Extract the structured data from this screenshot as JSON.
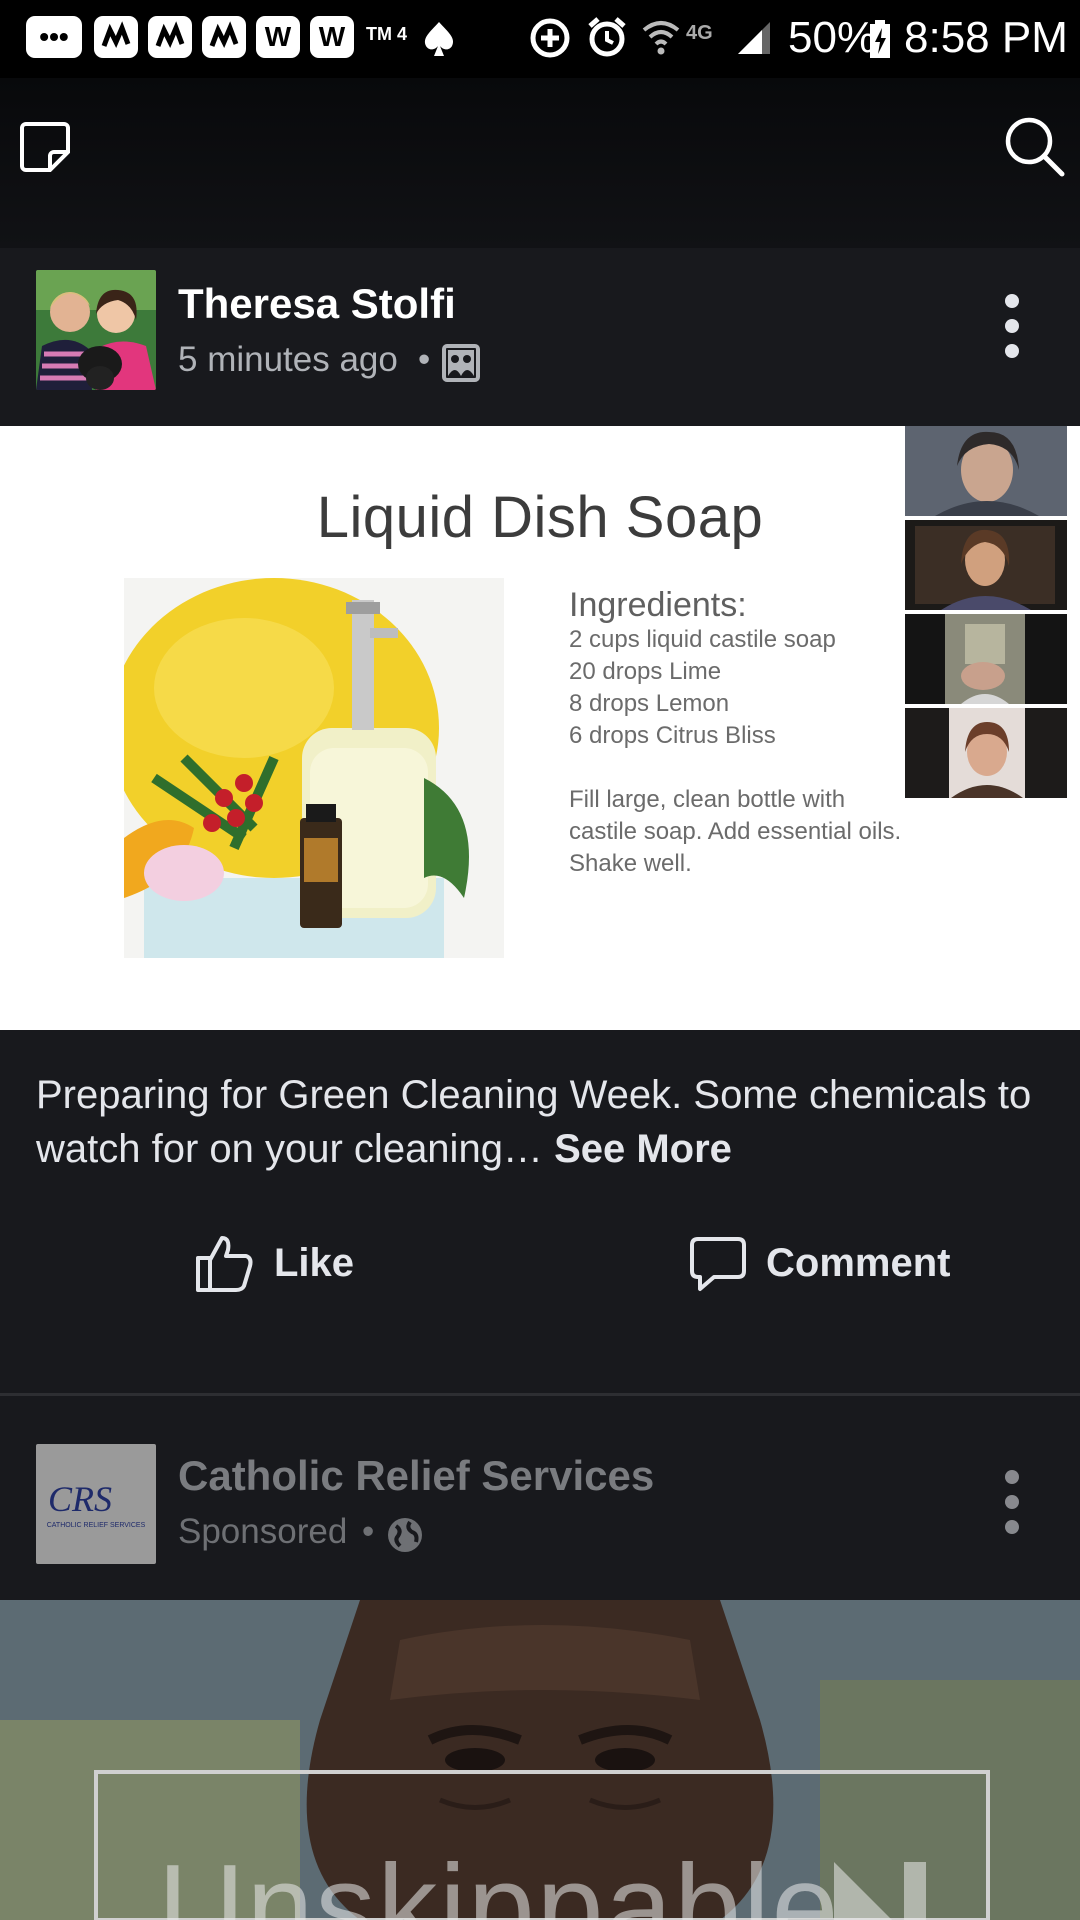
{
  "status_bar": {
    "badges": [
      "•••",
      "W",
      "W"
    ],
    "tmobile_label": "TM 4",
    "network": "4G",
    "battery": "50%",
    "time": "8:58 PM"
  },
  "post": {
    "author": "Theresa Stolfi",
    "time": "5 minutes ago",
    "separator": "•",
    "slide": {
      "title": "Liquid Dish Soap",
      "ingredients_heading": "Ingredients:",
      "ingredients": [
        "2 cups liquid castile soap",
        "20 drops Lime",
        "8 drops Lemon",
        "6 drops Citrus Bliss"
      ],
      "instructions": [
        "Fill large, clean bottle with",
        "castile soap. Add essential oils.",
        "Shake well."
      ]
    },
    "caption": "Preparing for Green Cleaning Week.  Some chemicals to watch for on your cleaning…",
    "see_more": "See More",
    "like_label": "Like",
    "comment_label": "Comment"
  },
  "ad": {
    "advertiser": "Catholic Relief Services",
    "logo_text": "CRS",
    "logo_subtext": "CATHOLIC RELIEF SERVICES",
    "sponsored": "Sponsored",
    "separator": "•",
    "overlay_text": "Unskippable"
  },
  "colors": {
    "background": "#18191d",
    "text_primary": "#e4e6eb",
    "text_secondary": "#b0b3b8"
  }
}
